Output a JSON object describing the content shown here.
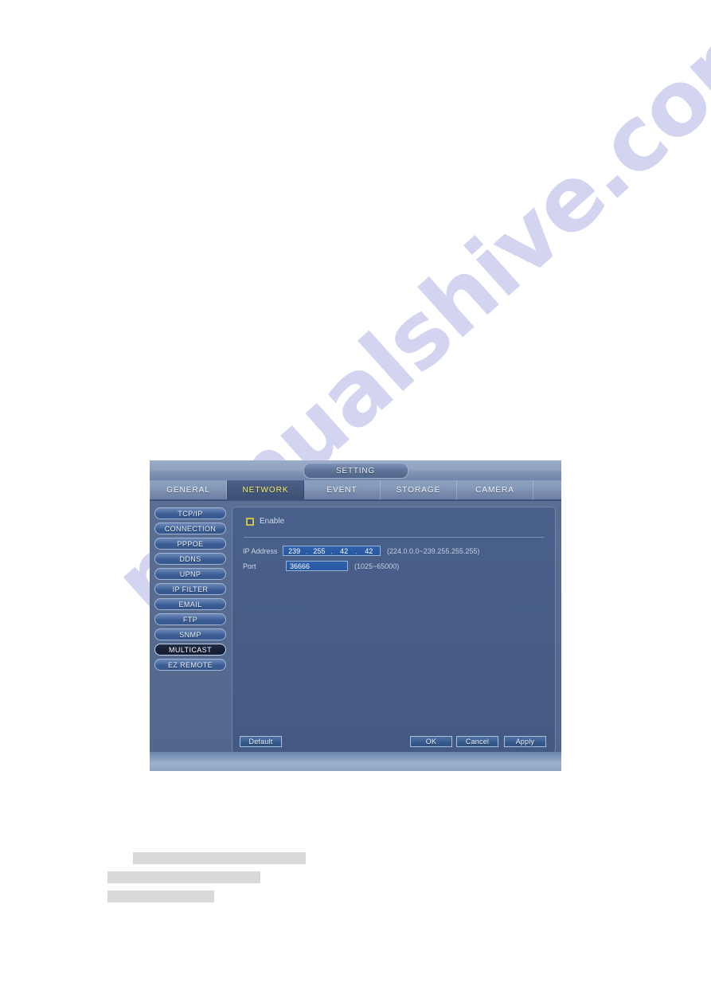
{
  "document": {
    "watermark_text": "manualshive.com"
  },
  "dialog": {
    "title": "SETTING",
    "tabs": [
      {
        "label": "GENERAL",
        "active": false
      },
      {
        "label": "NETWORK",
        "active": true
      },
      {
        "label": "EVENT",
        "active": false
      },
      {
        "label": "STORAGE",
        "active": false
      },
      {
        "label": "CAMERA",
        "active": false
      }
    ],
    "sidebar": {
      "items": [
        {
          "label": "TCP/IP",
          "active": false
        },
        {
          "label": "CONNECTION",
          "active": false
        },
        {
          "label": "PPPOE",
          "active": false
        },
        {
          "label": "DDNS",
          "active": false
        },
        {
          "label": "UPNP",
          "active": false
        },
        {
          "label": "IP FILTER",
          "active": false
        },
        {
          "label": "EMAIL",
          "active": false
        },
        {
          "label": "FTP",
          "active": false
        },
        {
          "label": "SNMP",
          "active": false
        },
        {
          "label": "MULTICAST",
          "active": true
        },
        {
          "label": "EZ REMOTE",
          "active": false
        }
      ]
    },
    "form": {
      "enable_label": "Enable",
      "enable_checked": false,
      "ip_label": "IP Address",
      "ip_octets": [
        "239",
        "255",
        "42",
        "42"
      ],
      "ip_separator": ".",
      "ip_hint": "(224.0.0.0~239.255.255.255)",
      "port_label": "Port",
      "port_value": "36666",
      "port_hint": "(1025~65000)"
    },
    "buttons": {
      "default": "Default",
      "ok": "OK",
      "cancel": "Cancel",
      "apply": "Apply"
    },
    "colors": {
      "active_tab_text": "#f2ef62",
      "panel_bg": "#475d86",
      "field_bg": "#2a5ca6",
      "checkbox_border": "#c6c24a",
      "active_nav_bg": "#17223a"
    }
  }
}
